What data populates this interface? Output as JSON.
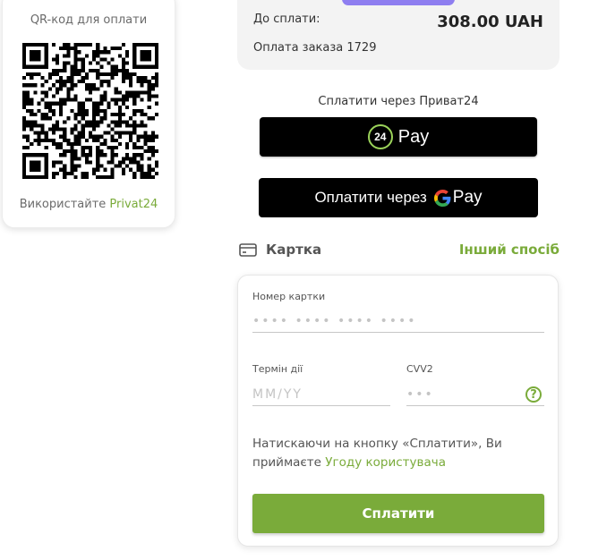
{
  "qr": {
    "title": "QR-код для оплати",
    "hint_prefix": "Використайте ",
    "hint_link": "Privat24"
  },
  "summary": {
    "amount_label": "До сплати:",
    "amount_value": "308.00 UAH",
    "description": "Оплата заказа 1729"
  },
  "privat": {
    "label": "Сплатити через Приват24",
    "badge": "24",
    "pay_text": "Pay"
  },
  "gpay": {
    "text": "Оплатити через",
    "pay_text": "Pay"
  },
  "card": {
    "title": "Картка",
    "other_method": "Інший спосіб",
    "card_number_label": "Номер картки",
    "card_number_placeholder": "•••• •••• •••• ••••",
    "expiry_label": "Термін дії",
    "expiry_placeholder": "MM/YY",
    "cvv_label": "CVV2",
    "cvv_placeholder": "•••",
    "help_symbol": "?",
    "terms_text": "Натискаючи на кнопку «Сплатити», Ви приймаєте ",
    "terms_link": "Угоду користувача",
    "submit": "Сплатити"
  },
  "colors": {
    "accent": "#7aab3a",
    "button_dark": "#000000",
    "summary_bg": "#f3f3f3",
    "pill": "#8e7ef0"
  }
}
